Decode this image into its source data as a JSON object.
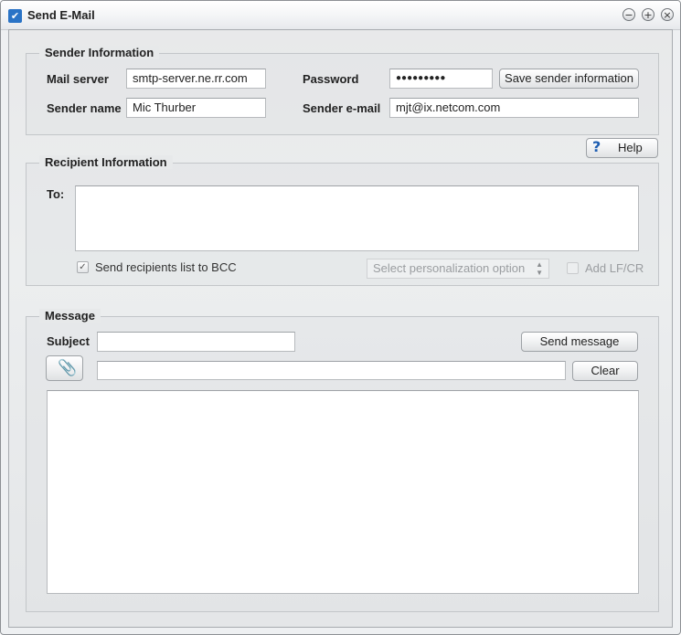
{
  "window": {
    "title": "Send E-Mail"
  },
  "sender": {
    "legend": "Sender Information",
    "mail_server_label": "Mail server",
    "mail_server_value": "smtp-server.ne.rr.com",
    "password_label": "Password",
    "password_value": "●●●●●●●●●",
    "save_button": "Save sender information",
    "sender_name_label": "Sender name",
    "sender_name_value": "Mic Thurber",
    "sender_email_label": "Sender e-mail",
    "sender_email_value": "mjt@ix.netcom.com"
  },
  "help_button": "Help",
  "recipient": {
    "legend": "Recipient Information",
    "to_label": "To:",
    "to_value": "",
    "bcc_label": "Send recipients list to BCC",
    "bcc_checked": true,
    "personalization_placeholder": "Select personalization option",
    "lfcr_label": "Add LF/CR"
  },
  "message": {
    "legend": "Message",
    "subject_label": "Subject",
    "subject_value": "",
    "send_button": "Send message",
    "attachment_value": "",
    "clear_button": "Clear",
    "body_value": ""
  }
}
